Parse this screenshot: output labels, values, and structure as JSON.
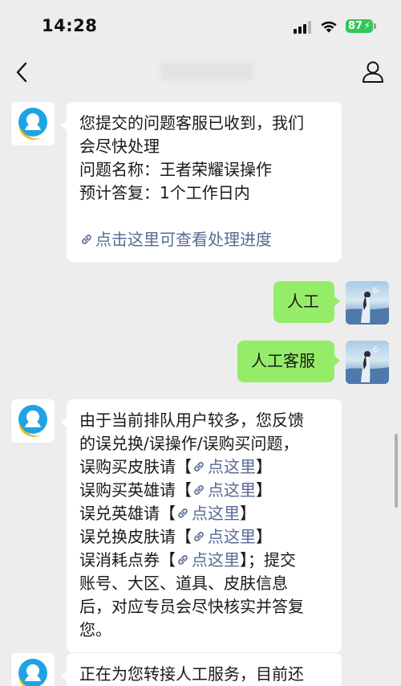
{
  "status_bar": {
    "time": "14:28",
    "battery": "87"
  },
  "nav": {
    "title": ""
  },
  "messages": {
    "m1": {
      "line1": "您提交的问题客服已收到，我们",
      "line2": "会尽快处理",
      "line3": "问题名称：王者荣耀误操作",
      "line4": "预计答复：1个工作日内",
      "link": "点击这里可查看处理进度"
    },
    "m2": {
      "text": "人工"
    },
    "m3": {
      "text": "人工客服"
    },
    "m4": {
      "line1": "由于当前排队用户较多，您反馈",
      "line2": "的误兑换/误操作/误购买问题，",
      "r1_prefix": "误购买皮肤请【",
      "r2_prefix": "误购买英雄请【",
      "r3_prefix": "误兑英雄请【",
      "r4_prefix": "误兑换皮肤请【",
      "r5_prefix": "误消耗点券【",
      "link": "点这里",
      "close": "】",
      "r5_suffix": "】；提交",
      "line8": "账号、大区、道具、皮肤信息",
      "line9": "后，对应专员会尽快核实并答复",
      "line10": "您。"
    },
    "m5": {
      "line1": "正在为您转接人工服务，目前还"
    }
  },
  "colors": {
    "bubble_right": "#95ec69",
    "bubble_left": "#ffffff",
    "link": "#576b95",
    "background": "#ededed"
  },
  "icons": [
    "signal-icon",
    "wifi-icon",
    "battery-icon",
    "back-icon",
    "profile-icon",
    "link-icon",
    "bot-avatar",
    "user-avatar"
  ]
}
